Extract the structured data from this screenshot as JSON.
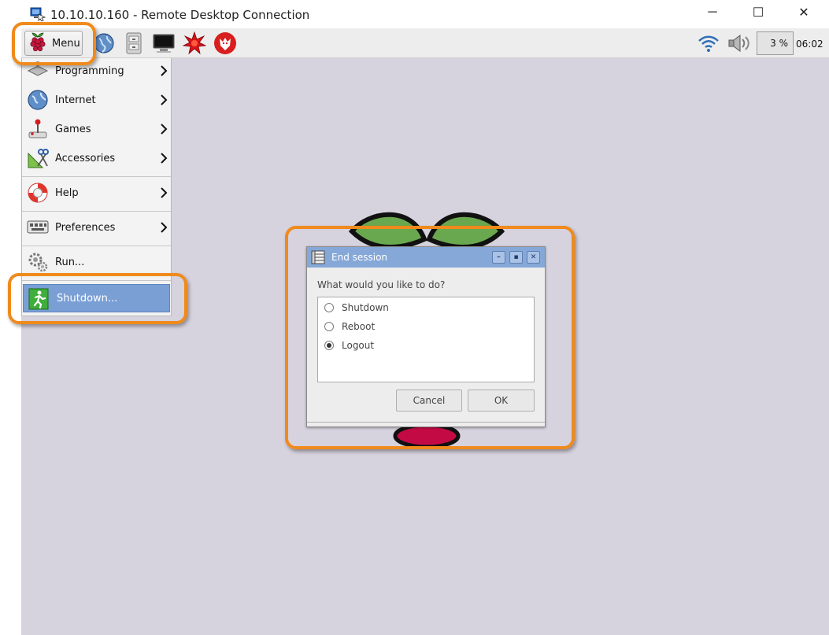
{
  "window": {
    "title": "10.10.10.160 - Remote Desktop Connection",
    "controls": {
      "minimize": "─",
      "maximize": "☐",
      "close": "✕"
    }
  },
  "panel": {
    "menu_label": "Menu",
    "launchers": [
      "browser-globe-icon",
      "file-manager-icon",
      "terminal-icon",
      "mathematica-icon",
      "wolfram-icon"
    ],
    "tray": {
      "wifi_icon": "wifi-icon",
      "volume_icon": "speaker-icon",
      "cpu_usage": "3 %",
      "clock": "06:02"
    }
  },
  "start_menu": {
    "items": [
      {
        "label": "Programming",
        "icon": "programming-icon",
        "submenu": true
      },
      {
        "label": "Internet",
        "icon": "internet-globe-icon",
        "submenu": true
      },
      {
        "label": "Games",
        "icon": "joystick-icon",
        "submenu": true
      },
      {
        "label": "Accessories",
        "icon": "accessories-tools-icon",
        "submenu": true
      },
      {
        "label": "Help",
        "icon": "lifebuoy-icon",
        "submenu": true
      },
      {
        "label": "Preferences",
        "icon": "preferences-keyboard-icon",
        "submenu": true
      },
      {
        "label": "Run...",
        "icon": "gears-icon",
        "submenu": false
      },
      {
        "label": "Shutdown...",
        "icon": "exit-running-man-icon",
        "submenu": false,
        "selected": true
      }
    ]
  },
  "dialog": {
    "title": "End session",
    "question": "What would you like to do?",
    "options": [
      {
        "label": "Shutdown",
        "checked": false
      },
      {
        "label": "Reboot",
        "checked": false
      },
      {
        "label": "Logout",
        "checked": true
      }
    ],
    "cancel_label": "Cancel",
    "ok_label": "OK"
  },
  "colors": {
    "desktop": "#d6d2de",
    "highlight": "#f08a1c",
    "menu_selected": "#7a9fd5",
    "dialog_title": "#85a8d8"
  }
}
